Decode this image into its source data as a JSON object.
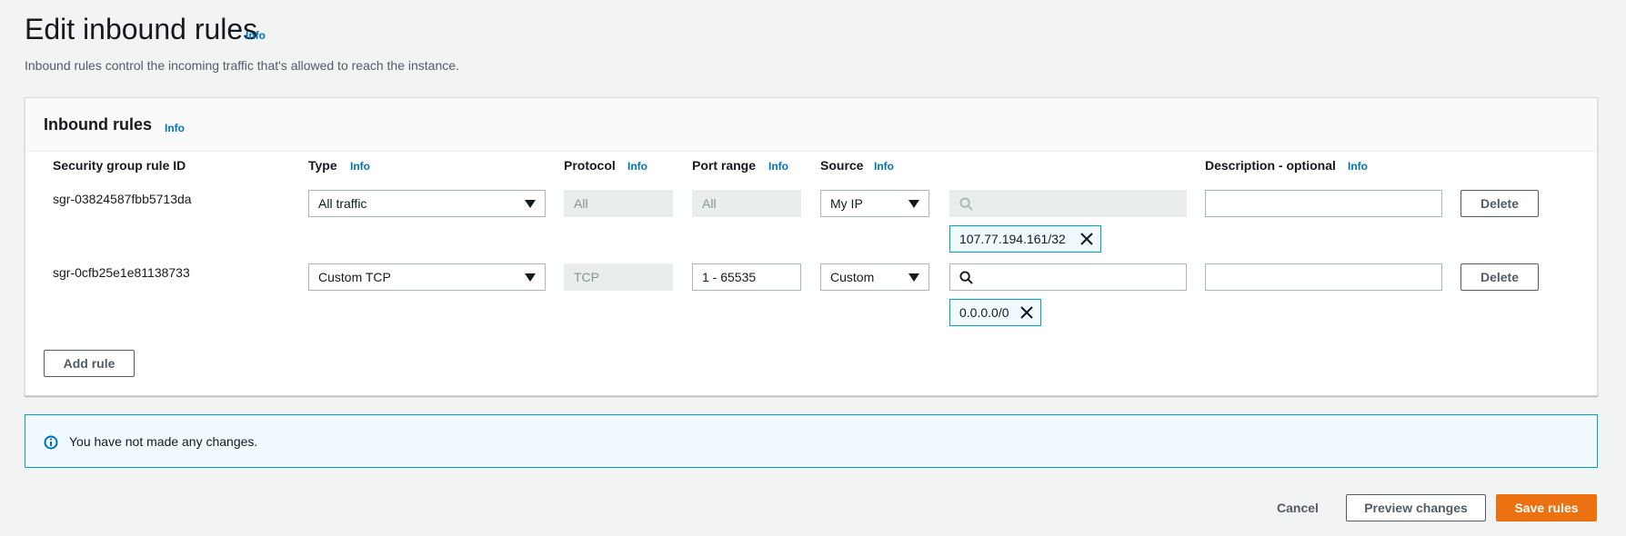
{
  "page": {
    "title": "Edit inbound rules",
    "title_info": "Info",
    "description": "Inbound rules control the incoming traffic that's allowed to reach the instance."
  },
  "panel": {
    "title": "Inbound rules",
    "title_info": "Info",
    "columns": {
      "rule_id": "Security group rule ID",
      "type": "Type",
      "type_info": "Info",
      "protocol": "Protocol",
      "protocol_info": "Info",
      "port_range": "Port range",
      "port_range_info": "Info",
      "source": "Source",
      "source_info": "Info",
      "description": "Description - optional",
      "description_info": "Info"
    },
    "rules": [
      {
        "id": "sgr-03824587fbb5713da",
        "type": "All traffic",
        "protocol": "All",
        "port_range": "All",
        "source": "My IP",
        "cidr_token": "107.77.194.161/32",
        "description": "",
        "delete_label": "Delete"
      },
      {
        "id": "sgr-0cfb25e1e81138733",
        "type": "Custom TCP",
        "protocol": "TCP",
        "port_range": "1 - 65535",
        "source": "Custom",
        "cidr_token": "0.0.0.0/0",
        "description": "",
        "delete_label": "Delete"
      }
    ],
    "add_rule_label": "Add rule"
  },
  "notice": {
    "text": "You have not made any changes."
  },
  "footer": {
    "cancel_label": "Cancel",
    "preview_label": "Preview changes",
    "save_label": "Save rules"
  },
  "colors": {
    "primary": "#ec7211",
    "link": "#0073bb",
    "info_border": "#00a1c9"
  },
  "icons": [
    "search-icon",
    "close-icon",
    "info-circle-icon"
  ]
}
